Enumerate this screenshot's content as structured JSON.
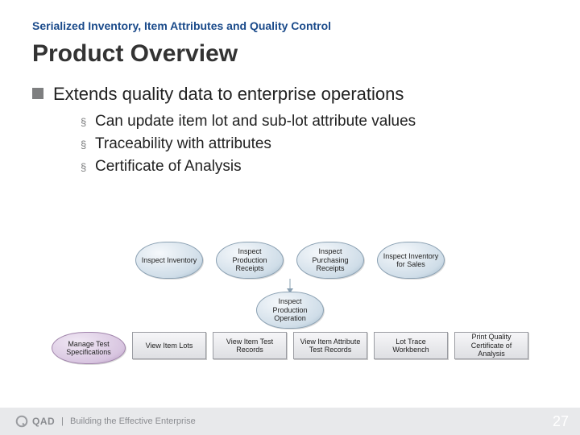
{
  "eyebrow": "Serialized Inventory, Item Attributes and Quality Control",
  "title": "Product Overview",
  "bullet_main": "Extends quality data to enterprise operations",
  "sub_bullets": [
    "Can update item lot and sub-lot attribute values",
    "Traceability with attributes",
    "Certificate of Analysis"
  ],
  "diagram": {
    "row1": [
      "Inspect Inventory",
      "Inspect Production Receipts",
      "Inspect Purchasing Receipts",
      "Inspect Inventory for Sales"
    ],
    "row2": "Inspect Production Operation",
    "row3_left": "Manage Test Specifications",
    "row3_rects": [
      "View Item Lots",
      "View Item Test Records",
      "View Item Attribute Test Records",
      "Lot Trace Workbench",
      "Print Quality Certificate of Analysis"
    ]
  },
  "footer": {
    "brand": "QAD",
    "tagline": "Building the Effective Enterprise",
    "page": "27"
  }
}
